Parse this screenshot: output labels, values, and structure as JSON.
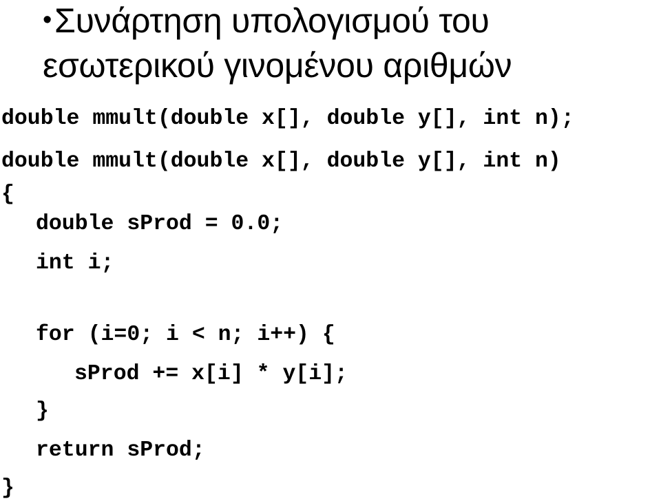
{
  "slide": {
    "title_bullet": "•",
    "title_line1": "Συνάρτηση υπολογισμού του",
    "title_line2": "εσωτερικού γινομένου αριθμών",
    "code": {
      "prototype": "double mmult(double x[], double y[], int n);",
      "signature": "double mmult(double x[], double y[], int n)",
      "open_brace": "{",
      "decl_sprod": "double sProd = 0.0;",
      "decl_i": "int i;",
      "for_header": "for (i=0; i < n; i++) {",
      "loop_body": "sProd += x[i] * y[i];",
      "for_close": "}",
      "return_stmt": "return sProd;",
      "close_brace": "}"
    }
  }
}
